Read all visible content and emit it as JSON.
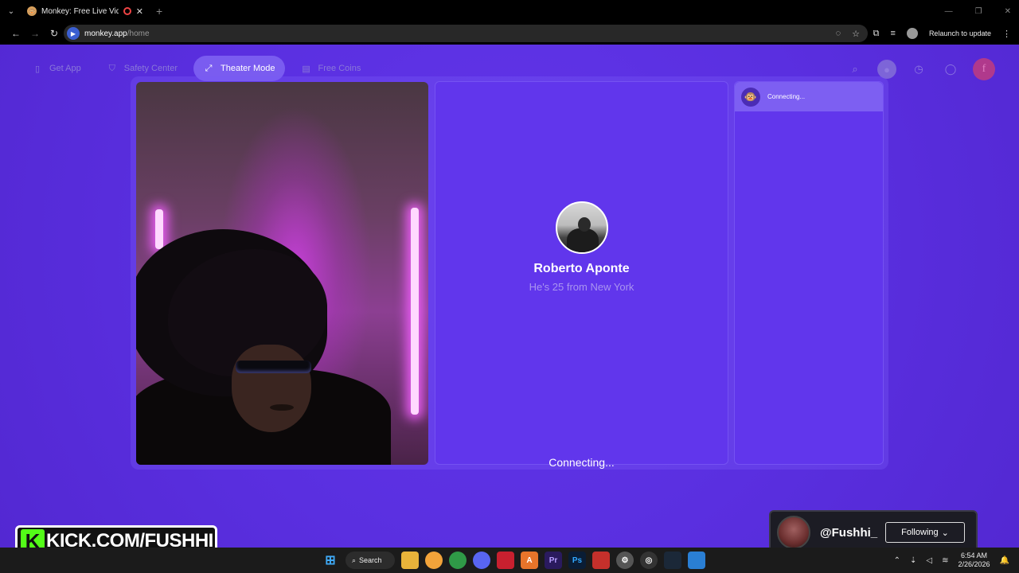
{
  "browser": {
    "tab_title": "Monkey: Free Live Video Ch",
    "url_host": "monkey.app",
    "url_path": "/home",
    "relaunch_label": "Relaunch to update"
  },
  "nav": {
    "get_app": "Get App",
    "safety_center": "Safety Center",
    "theater_mode": "Theater Mode",
    "free_coins": "Free Coins",
    "facebook": "f"
  },
  "partner": {
    "name": "Roberto Aponte",
    "subtitle": "He's 25 from New York",
    "status": "Connecting..."
  },
  "chat": {
    "status": "Connecting..."
  },
  "overlay": {
    "handle": "@Fushhi_",
    "follow_button": "Following",
    "kick_letter": "K",
    "kick_text": "KICK.COM/FUSHHI"
  },
  "taskbar": {
    "search_label": "Search",
    "time": "6:54 AM",
    "date": "2/26/2026"
  },
  "colors": {
    "page_bg": "#5a2fe0",
    "panel": "#6136ec",
    "accent_active": "#7a5cf0",
    "kick_green": "#53fc18"
  }
}
